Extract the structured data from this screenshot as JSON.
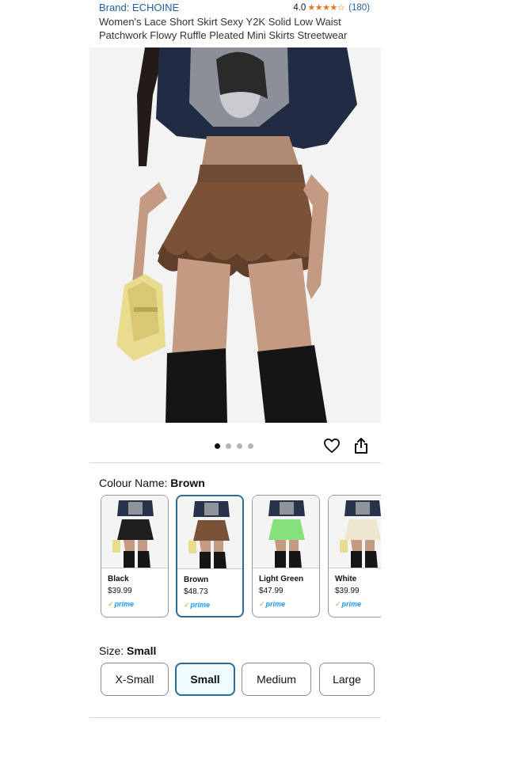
{
  "brand": {
    "label": "Brand: ECHOINE"
  },
  "rating": {
    "value": "4.0",
    "stars": "★★★★☆",
    "count": "(180)"
  },
  "product": {
    "title": "Women's Lace Short Skirt Sexy Y2K Solid Low Waist Patchwork Flowy Ruffle Pleated Mini Skirts Streetwear"
  },
  "gallery": {
    "total_images": 4,
    "active_index": 0
  },
  "colour": {
    "label": "Colour Name: ",
    "selected": "Brown",
    "options": [
      {
        "name": "Black",
        "price": "$39.99",
        "prime": "prime",
        "skirt_color": "#1f1f1f"
      },
      {
        "name": "Brown",
        "price": "$48.73",
        "prime": "prime",
        "skirt_color": "#7a5238"
      },
      {
        "name": "Light Green",
        "price": "$47.99",
        "prime": "prime",
        "skirt_color": "#86e07e"
      },
      {
        "name": "White",
        "price": "$39.99",
        "prime": "prime",
        "skirt_color": "#efe6cf"
      }
    ]
  },
  "size": {
    "label": "Size: ",
    "selected": "Small",
    "options": [
      "X-Small",
      "Small",
      "Medium",
      "Large"
    ]
  },
  "price": {
    "currency": "$",
    "whole": "48",
    "fraction": "73"
  },
  "colors": {
    "link": "#2162a1",
    "star": "#de7921",
    "selected_border": "#2e6b93",
    "prime": "#1a98ff"
  },
  "icons": {
    "wishlist": "heart-icon",
    "share": "share-icon",
    "prime_check": "prime-check-icon"
  }
}
